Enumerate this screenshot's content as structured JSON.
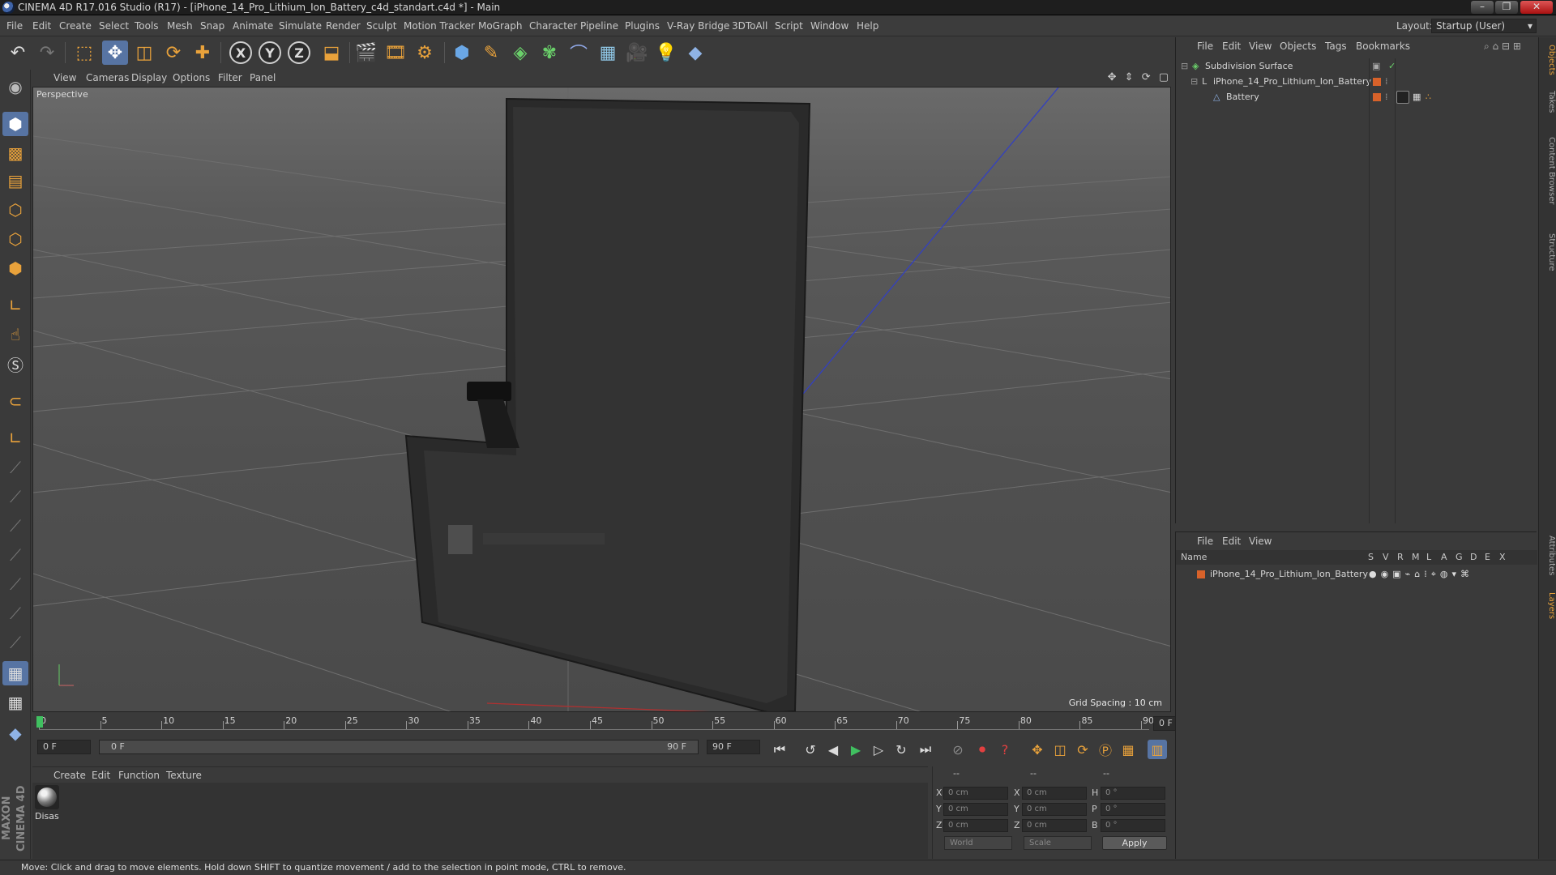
{
  "window": {
    "title": "CINEMA 4D R17.016 Studio (R17) - [iPhone_14_Pro_Lithium_Ion_Battery_c4d_standart.c4d *] - Main",
    "minimize": "–",
    "maximize": "❐",
    "close": "✕"
  },
  "menu": [
    "File",
    "Edit",
    "Create",
    "Select",
    "Tools",
    "Mesh",
    "Snap",
    "Animate",
    "Simulate",
    "Render",
    "Sculpt",
    "Motion Tracker",
    "MoGraph",
    "Character",
    "Pipeline",
    "Plugins",
    "V-Ray Bridge",
    "3DToAll",
    "Script",
    "Window",
    "Help"
  ],
  "layout": {
    "label": "Layout:",
    "value": "Startup (User)"
  },
  "toolbar": {
    "x_axis": "X",
    "y_axis": "Y",
    "z_axis": "Z"
  },
  "viewport": {
    "menu": [
      "View",
      "Cameras",
      "Display",
      "Options",
      "Filter",
      "Panel"
    ],
    "name": "Perspective",
    "grid_spacing": "Grid Spacing : 10 cm",
    "nav_icons": "✥ ⇕ ⟳ ▢"
  },
  "timeline": {
    "ticks": [
      "0",
      "5",
      "10",
      "15",
      "20",
      "25",
      "30",
      "35",
      "40",
      "45",
      "50",
      "55",
      "60",
      "65",
      "70",
      "75",
      "80",
      "85",
      "90"
    ],
    "current_frame": "0 F",
    "start": "0 F",
    "range_start": "0 F",
    "range_end": "90 F",
    "end": "90 F",
    "playhead": 0
  },
  "materials": {
    "menu": [
      "Create",
      "Edit",
      "Function",
      "Texture"
    ],
    "items": [
      {
        "name": "Disas"
      }
    ]
  },
  "coords": {
    "headers": [
      "--",
      "--",
      "--"
    ],
    "pos_labels": [
      "X",
      "Y",
      "Z"
    ],
    "size_labels": [
      "X",
      "Y",
      "Z"
    ],
    "rot_labels": [
      "H",
      "P",
      "B"
    ],
    "pos_values": [
      "0 cm",
      "0 cm",
      "0 cm"
    ],
    "size_values": [
      "0 cm",
      "0 cm",
      "0 cm"
    ],
    "rot_values": [
      "0 °",
      "0 °",
      "0 °"
    ],
    "mode": "World",
    "size_mode": "Scale",
    "apply": "Apply"
  },
  "objects": {
    "menu": [
      "File",
      "Edit",
      "View",
      "Objects",
      "Tags",
      "Bookmarks"
    ],
    "rows": [
      {
        "name": "Subdivision Surface",
        "level": 0
      },
      {
        "name": "iPhone_14_Pro_Lithium_Ion_Battery",
        "level": 1
      },
      {
        "name": "Battery",
        "level": 2
      }
    ]
  },
  "layers": {
    "menu": [
      "File",
      "Edit",
      "View"
    ],
    "col_name": "Name",
    "cols": [
      "S",
      "V",
      "R",
      "M",
      "L",
      "A",
      "G",
      "D",
      "E",
      "X"
    ],
    "rows": [
      {
        "name": "iPhone_14_Pro_Lithium_Ion_Battery",
        "color": "#d8622a"
      }
    ]
  },
  "right_tabs": [
    "Objects",
    "Takes",
    "Content Browser",
    "Structure",
    "Attributes",
    "Layers"
  ],
  "status": "Move: Click and drag to move elements. Hold down SHIFT to quantize movement / add to the selection in point mode, CTRL to remove.",
  "colors": {
    "accent": "#e9a23b",
    "active_tool": "#5774a3",
    "layer_orange": "#d8622a"
  },
  "logo_text": "MAXON CINEMA 4D"
}
